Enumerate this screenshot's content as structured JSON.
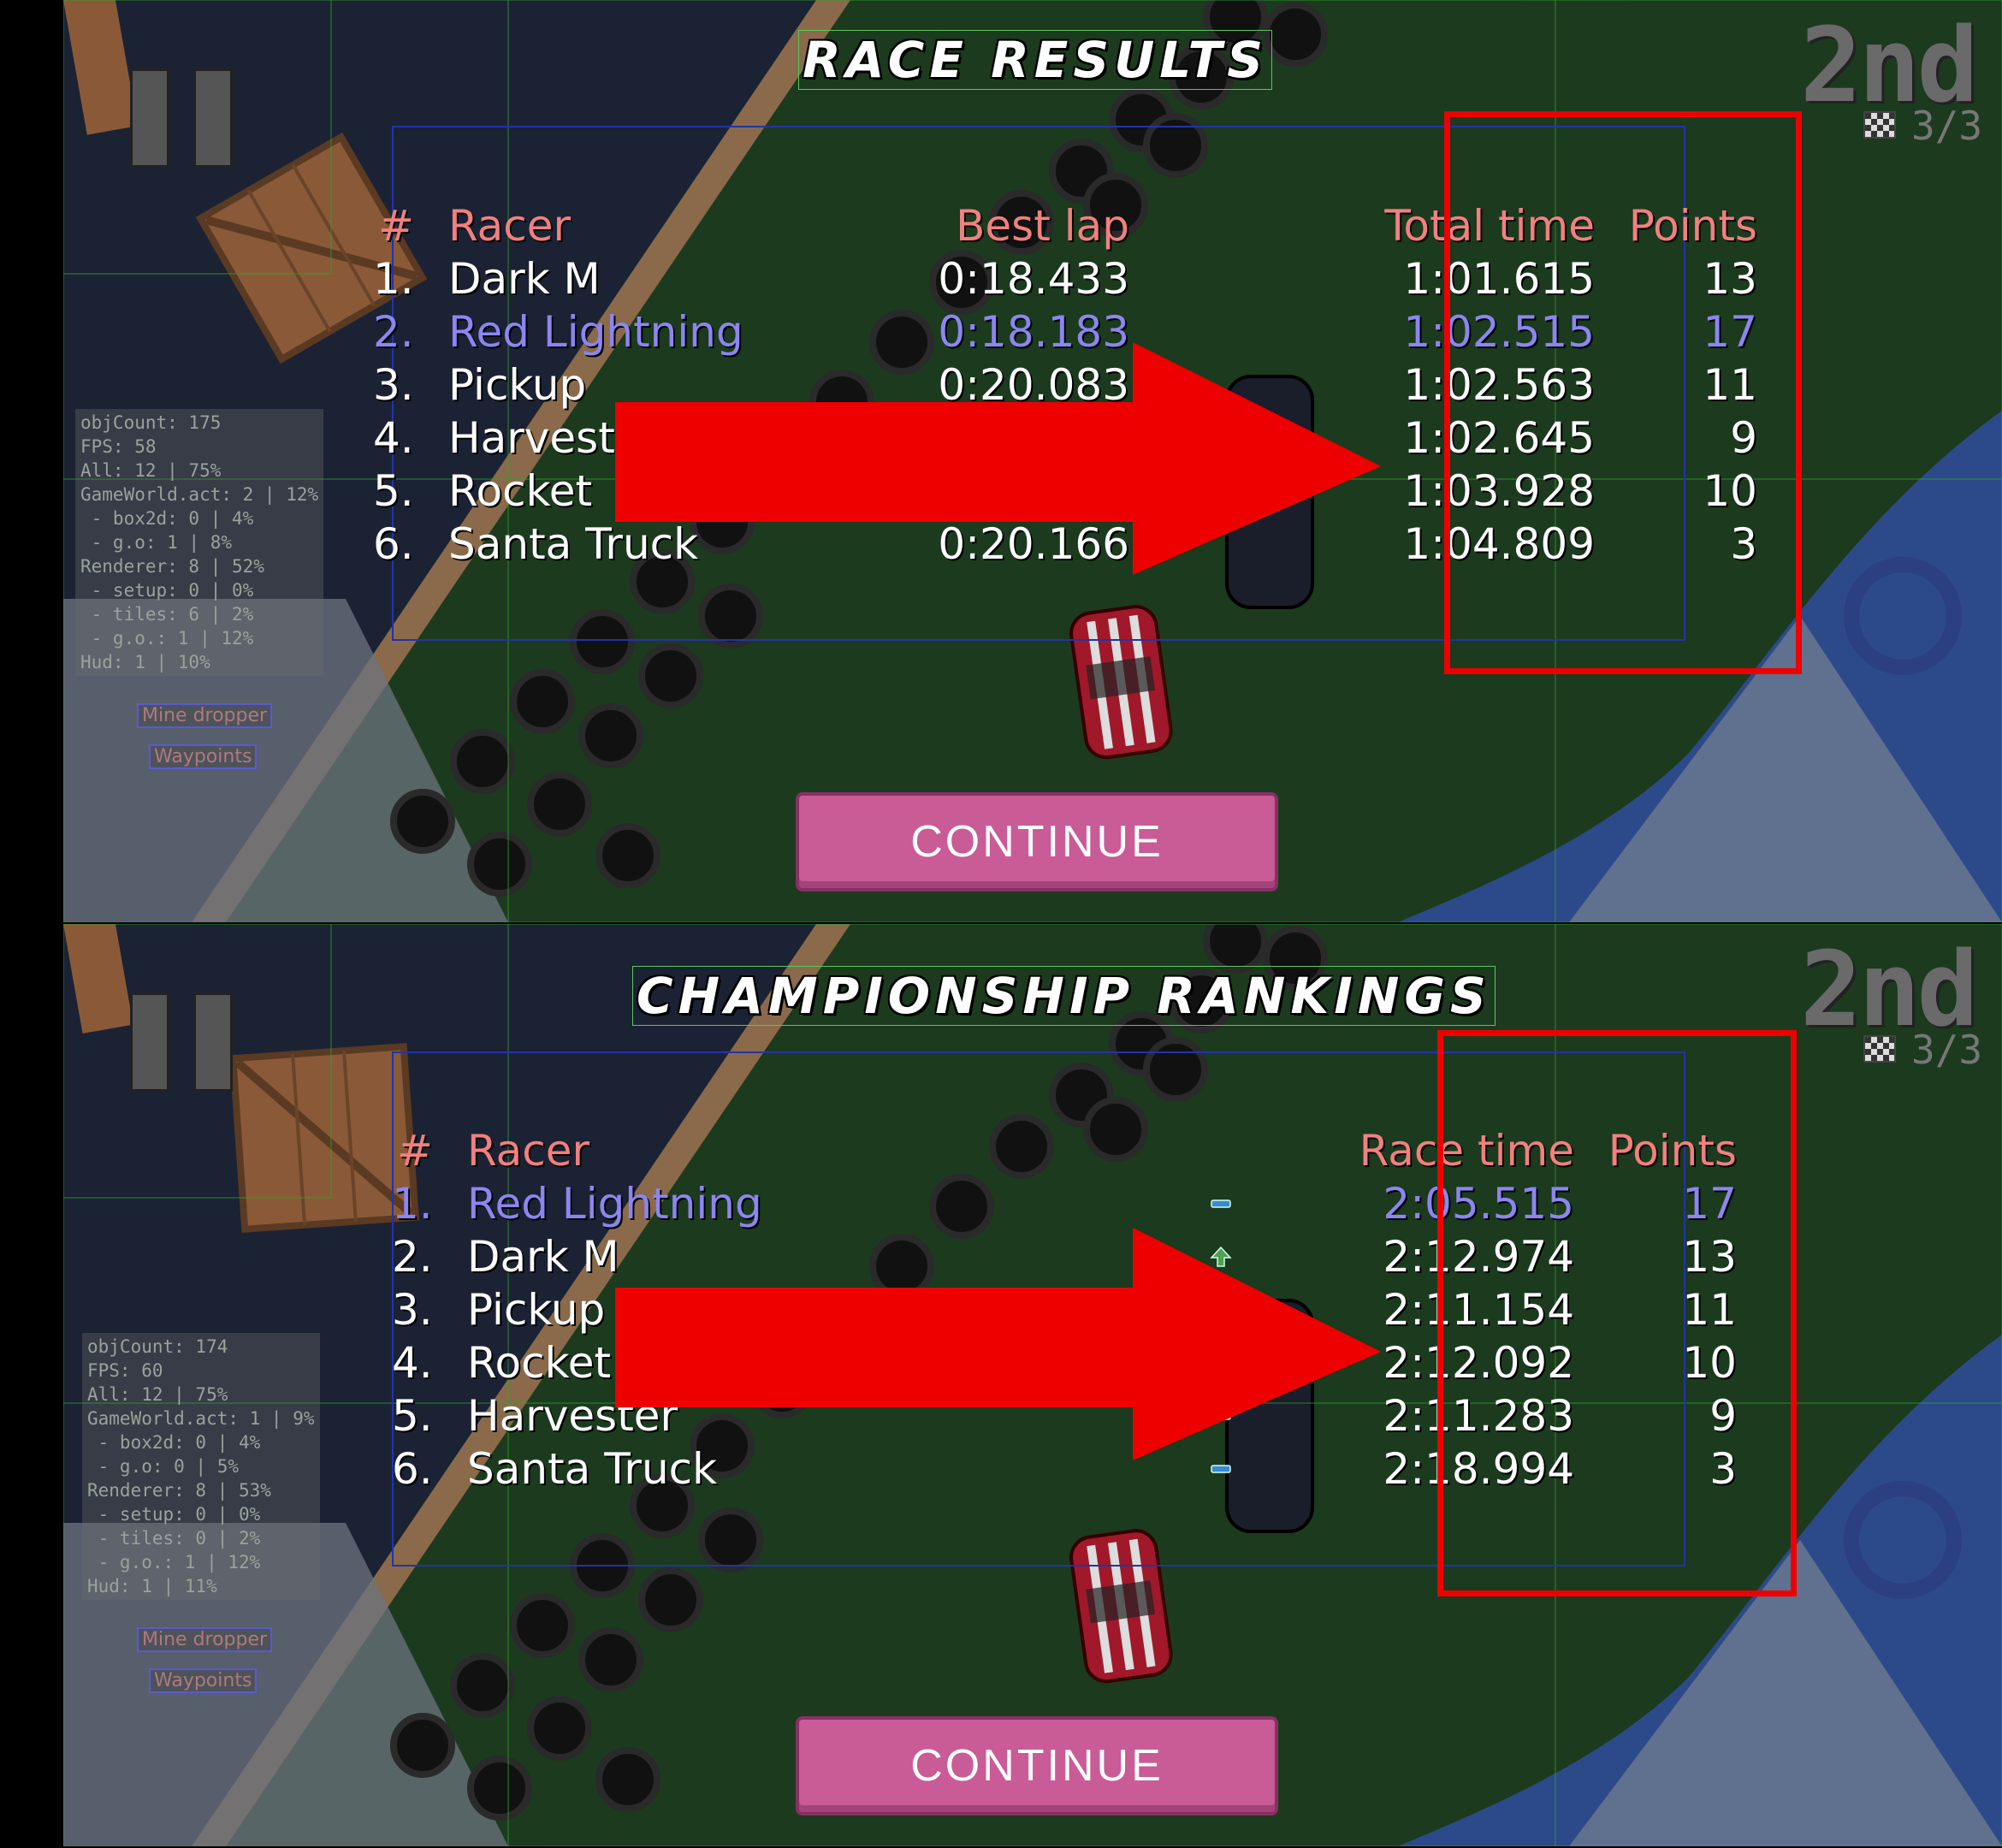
{
  "top_screen": {
    "title": "RACE RESULTS",
    "position": "2nd",
    "lap": "3/3",
    "columns": [
      "#",
      "Racer",
      "Best lap",
      "Total time",
      "Points"
    ],
    "rows": [
      {
        "rank": "1.",
        "racer": "Dark M",
        "best_lap": "0:18.433",
        "total_time": "1:01.615",
        "points": "13",
        "highlight": false
      },
      {
        "rank": "2.",
        "racer": "Red Lightning",
        "best_lap": "0:18.183",
        "total_time": "1:02.515",
        "points": "17",
        "highlight": true
      },
      {
        "rank": "3.",
        "racer": "Pickup",
        "best_lap": "0:20.083",
        "total_time": "1:02.563",
        "points": "11",
        "highlight": false
      },
      {
        "rank": "4.",
        "racer": "Harvest",
        "best_lap": "",
        "total_time": "1:02.645",
        "points": "9",
        "highlight": false
      },
      {
        "rank": "5.",
        "racer": "Rocket",
        "best_lap": "",
        "total_time": "1:03.928",
        "points": "10",
        "highlight": false
      },
      {
        "rank": "6.",
        "racer": "Santa Truck",
        "best_lap": "0:20.166",
        "total_time": "1:04.809",
        "points": "3",
        "highlight": false
      }
    ],
    "continue_label": "CONTINUE",
    "debug": {
      "lines": [
        "objCount: 175",
        "FPS: 58",
        "All: 12 | 75%",
        "GameWorld.act: 2 | 12%",
        " - box2d: 0 | 4%",
        " - g.o: 1 | 8%",
        "Renderer: 8 | 52%",
        " - setup: 0 | 0%",
        " - tiles: 6 | 2%",
        " - g.o.: 1 | 12%",
        "Hud: 1 | 10%"
      ],
      "mine_dropper": "Mine dropper",
      "waypoints": "Waypoints"
    }
  },
  "bottom_screen": {
    "title": "CHAMPIONSHIP RANKINGS",
    "position": "2nd",
    "lap": "3/3",
    "columns": [
      "#",
      "Racer",
      "Race time",
      "Points"
    ],
    "rows": [
      {
        "rank": "1.",
        "racer": "Red Lightning",
        "change": "same",
        "race_time": "2:05.515",
        "points": "17",
        "highlight": true
      },
      {
        "rank": "2.",
        "racer": "Dark M",
        "change": "up",
        "race_time": "2:12.974",
        "points": "13",
        "highlight": false
      },
      {
        "rank": "3.",
        "racer": "Pickup",
        "change": "",
        "race_time": "2:11.154",
        "points": "11",
        "highlight": false
      },
      {
        "rank": "4.",
        "racer": "Rocket",
        "change": "",
        "race_time": "2:12.092",
        "points": "10",
        "highlight": false
      },
      {
        "rank": "5.",
        "racer": "Harvester",
        "change": "same",
        "race_time": "2:11.283",
        "points": "9",
        "highlight": false
      },
      {
        "rank": "6.",
        "racer": "Santa Truck",
        "change": "same",
        "race_time": "2:18.994",
        "points": "3",
        "highlight": false
      }
    ],
    "continue_label": "CONTINUE",
    "debug": {
      "lines": [
        "objCount: 174",
        "FPS: 60",
        "All: 12 | 75%",
        "GameWorld.act: 1 | 9%",
        " - box2d: 0 | 4%",
        " - g.o: 0 | 5%",
        "Renderer: 8 | 53%",
        " - setup: 0 | 0%",
        " - tiles: 0 | 2%",
        " - g.o.: 1 | 12%",
        "Hud: 1 | 11%"
      ],
      "mine_dropper": "Mine dropper",
      "waypoints": "Waypoints"
    }
  },
  "colors": {
    "header": "#f2807f",
    "highlight": "#8b86f0",
    "grass": "#1c3a1e",
    "annotation_red": "#ee0000",
    "button": "#c95b97"
  }
}
